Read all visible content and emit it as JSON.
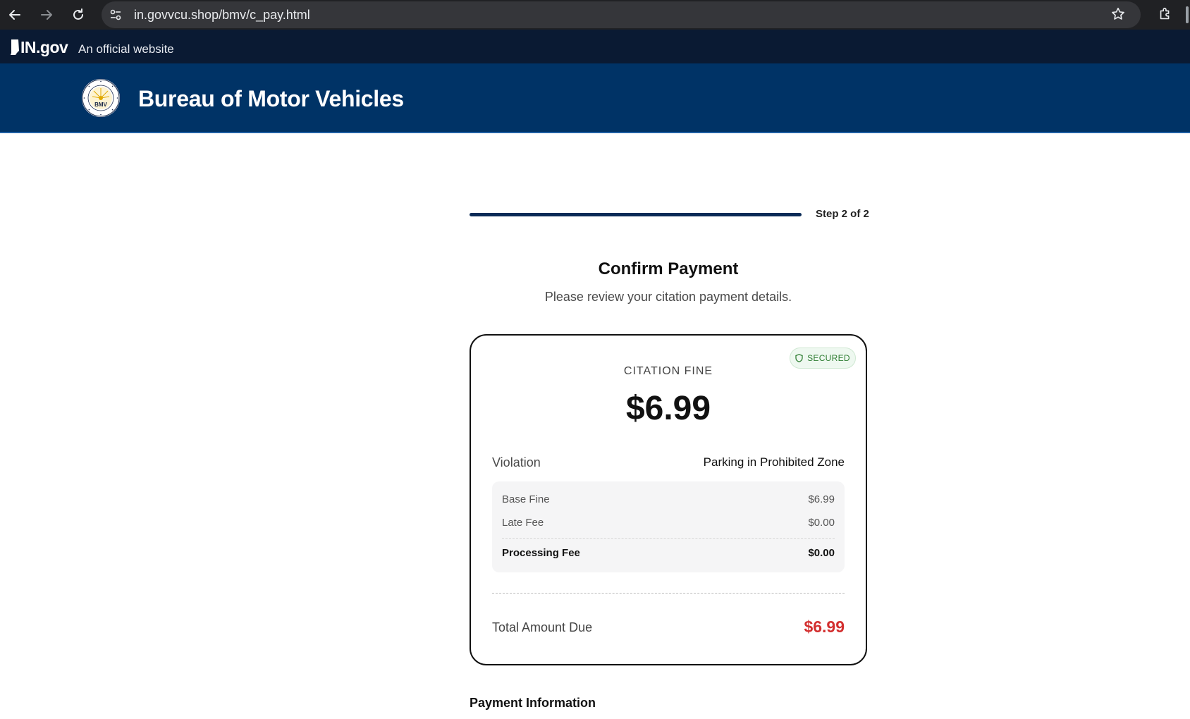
{
  "browser": {
    "url": "in.govvcu.shop/bmv/c_pay.html"
  },
  "gov_bar": {
    "logo_text": "IN.gov",
    "official_text": "An official website"
  },
  "header": {
    "title": "Bureau of Motor Vehicles",
    "seal_text": "BMV",
    "seal_ring_top": "BUREAU OF MOTOR VEHICLES",
    "seal_ring_bottom": "INDIANA"
  },
  "progress": {
    "step_label": "Step 2 of 2",
    "fraction": 1.0
  },
  "confirm": {
    "title": "Confirm Payment",
    "subtitle": "Please review your citation payment details."
  },
  "card": {
    "secured_badge": "SECURED",
    "fine_label": "CITATION FINE",
    "fine_amount": "$6.99",
    "violation_label": "Violation",
    "violation_value": "Parking in Prohibited Zone",
    "fees": [
      {
        "label": "Base Fine",
        "value": "$6.99"
      },
      {
        "label": "Late Fee",
        "value": "$0.00"
      },
      {
        "label": "Processing Fee",
        "value": "$0.00"
      }
    ],
    "total_label": "Total Amount Due",
    "total_value": "$6.99"
  },
  "payment_info_heading": "Payment Information",
  "colors": {
    "header_bg": "#003366",
    "gov_bar_bg": "#0a1a33",
    "total_red": "#d32f2f",
    "secured_green": "#2e7d32"
  }
}
